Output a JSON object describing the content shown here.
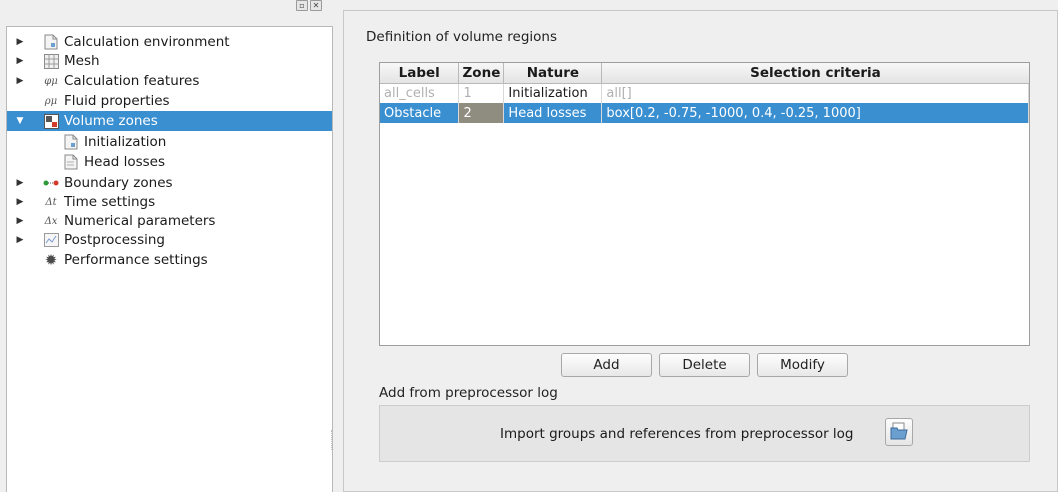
{
  "dock": {
    "float_icon": "float-icon",
    "close_icon": "close-icon"
  },
  "tree": {
    "items": [
      {
        "label": "Calculation environment",
        "icon": "document-icon",
        "expandable": true,
        "selected": false
      },
      {
        "label": "Mesh",
        "icon": "grid-icon",
        "expandable": true,
        "selected": false
      },
      {
        "label": "Calculation features",
        "icon": "phi-mu-icon",
        "expandable": true,
        "selected": false
      },
      {
        "label": "Fluid properties",
        "icon": "rho-mu-icon",
        "expandable": false,
        "selected": false
      },
      {
        "label": "Volume zones",
        "icon": "volume-zones-icon",
        "expandable": true,
        "expanded": true,
        "selected": true
      },
      {
        "label": "Initialization",
        "icon": "document-icon",
        "child": true,
        "selected": false
      },
      {
        "label": "Head losses",
        "icon": "document-icon",
        "child": true,
        "selected": false
      },
      {
        "label": "Boundary zones",
        "icon": "boundary-icon",
        "expandable": true,
        "selected": false
      },
      {
        "label": "Time settings",
        "icon": "delta-t-icon",
        "expandable": true,
        "selected": false
      },
      {
        "label": "Numerical parameters",
        "icon": "delta-x-icon",
        "expandable": true,
        "selected": false
      },
      {
        "label": "Postprocessing",
        "icon": "chart-icon",
        "expandable": true,
        "selected": false
      },
      {
        "label": "Performance settings",
        "icon": "gear-icon",
        "expandable": false,
        "selected": false
      }
    ],
    "icon_glyphs": {
      "phi-mu": "φμ",
      "rho-mu": "ρμ",
      "delta-t": "Δt",
      "delta-x": "Δx"
    }
  },
  "main": {
    "title": "Definition of volume regions",
    "table": {
      "headers": [
        "Label",
        "Zone",
        "Nature",
        "Selection criteria"
      ],
      "rows": [
        {
          "label": "all_cells",
          "zone": "1",
          "nature": "Initialization",
          "criteria": "all[]",
          "state": "disabled"
        },
        {
          "label": "Obstacle",
          "zone": "2",
          "nature": "Head losses",
          "criteria": "box[0.2, -0.75, -1000, 0.4, -0.25, 1000]",
          "state": "selected"
        }
      ]
    },
    "buttons": {
      "add": "Add",
      "delete": "Delete",
      "modify": "Modify"
    },
    "preprocessor_title": "Add from preprocessor log",
    "import_label": "Import groups and references from preprocessor log",
    "import_icon": "folder-open-icon"
  },
  "colors": {
    "selection": "#3a8fd1",
    "zone_selected": "#8f8c80",
    "disabled_text": "#b0b0b0"
  }
}
